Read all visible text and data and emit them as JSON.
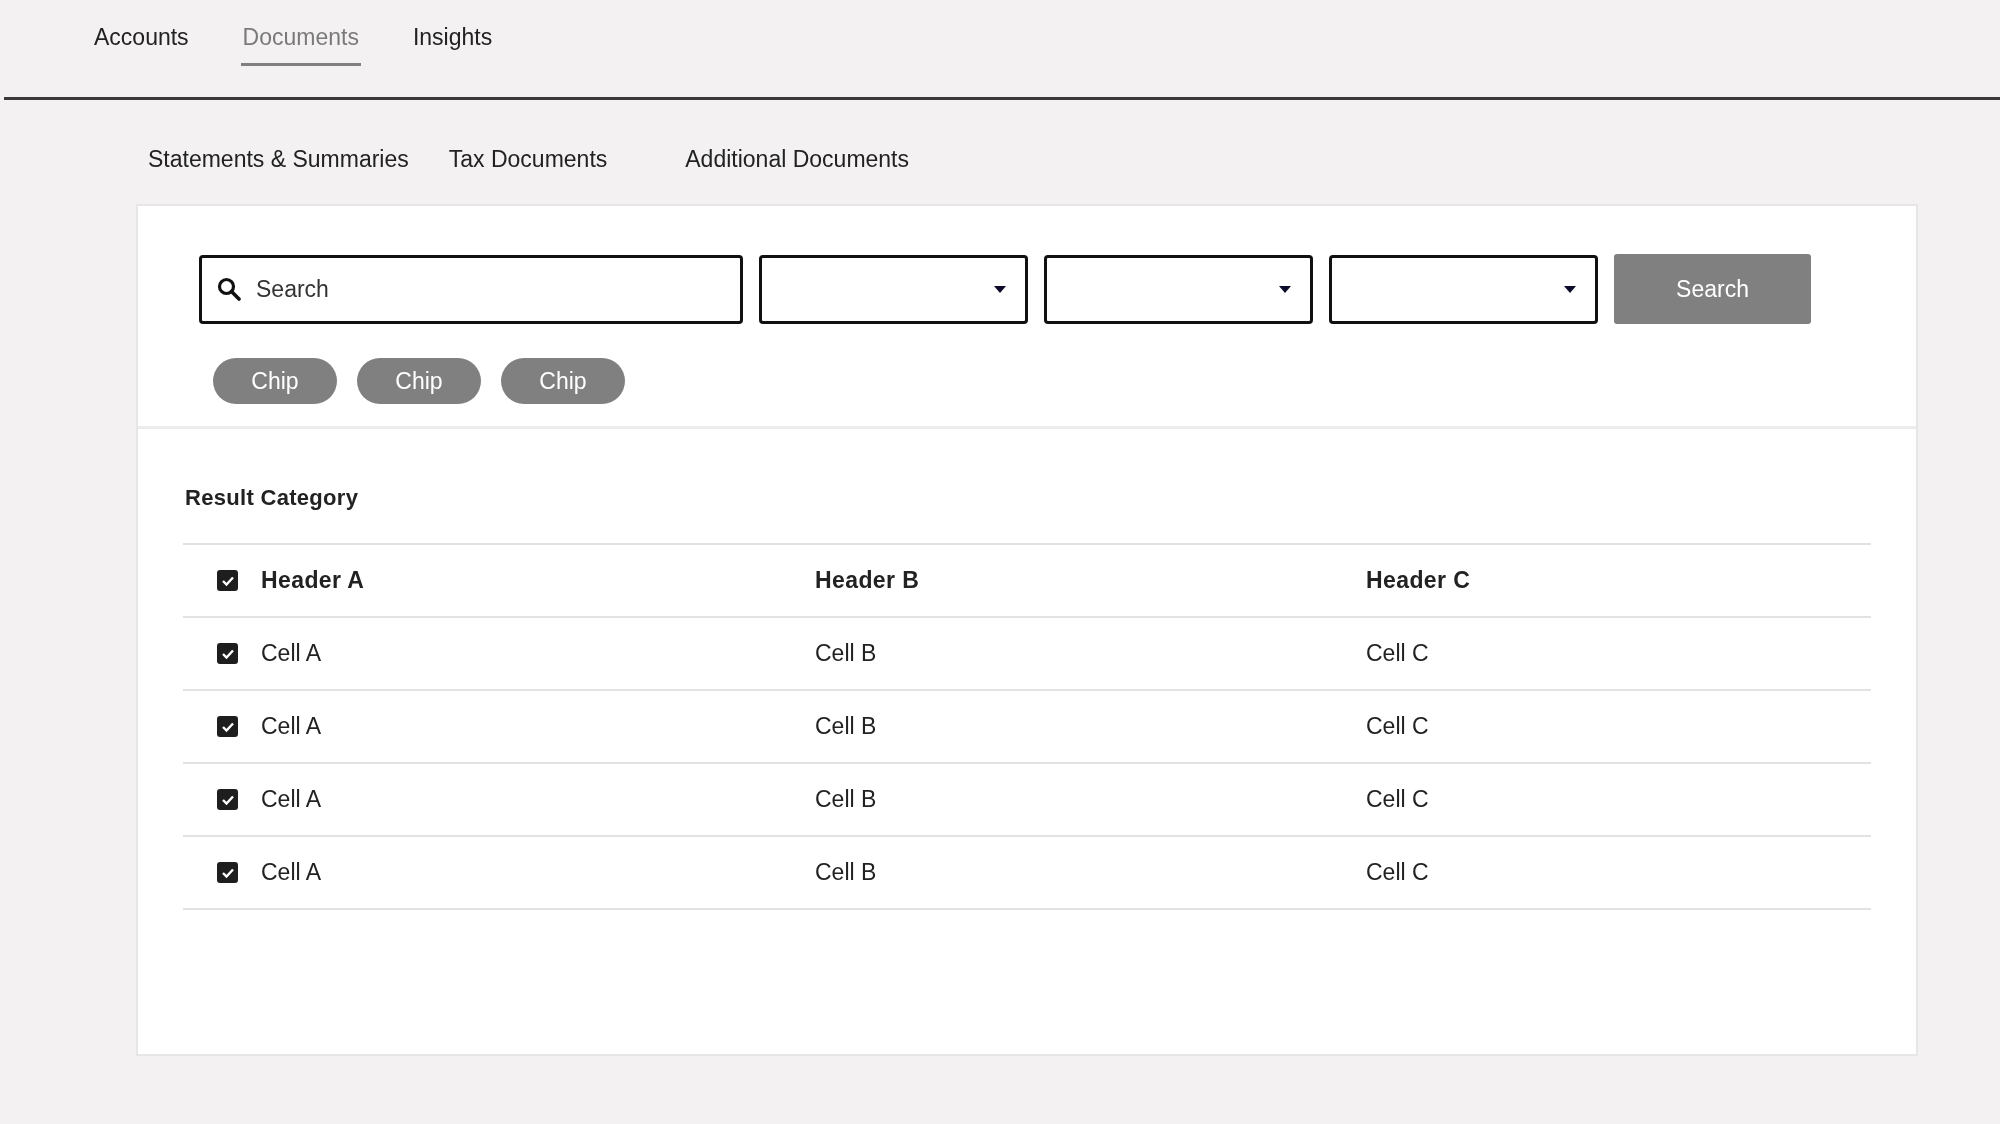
{
  "top_tabs": [
    {
      "label": "Accounts",
      "selected": false
    },
    {
      "label": "Documents",
      "selected": true
    },
    {
      "label": "Insights",
      "selected": false
    }
  ],
  "sub_tabs": [
    {
      "label": "Statements & Summaries"
    },
    {
      "label": "Tax Documents"
    },
    {
      "label": "Additional Documents"
    }
  ],
  "search": {
    "placeholder": "Search"
  },
  "dropdowns": [
    {
      "expanded": false
    },
    {
      "expanded": false
    },
    {
      "expanded": false
    }
  ],
  "search_button": "Search",
  "chips": [
    "Chip",
    "Chip",
    "Chip"
  ],
  "results": {
    "title": "Result Category",
    "header": {
      "checked": true,
      "columns": [
        "Header A",
        "Header B",
        "Header C"
      ]
    },
    "rows": [
      {
        "checked": true,
        "cells": [
          "Cell A",
          "Cell B",
          "Cell C"
        ]
      },
      {
        "checked": true,
        "cells": [
          "Cell A",
          "Cell B",
          "Cell C"
        ]
      },
      {
        "checked": true,
        "cells": [
          "Cell A",
          "Cell B",
          "Cell C"
        ]
      },
      {
        "checked": true,
        "cells": [
          "Cell A",
          "Cell B",
          "Cell C"
        ]
      }
    ]
  }
}
